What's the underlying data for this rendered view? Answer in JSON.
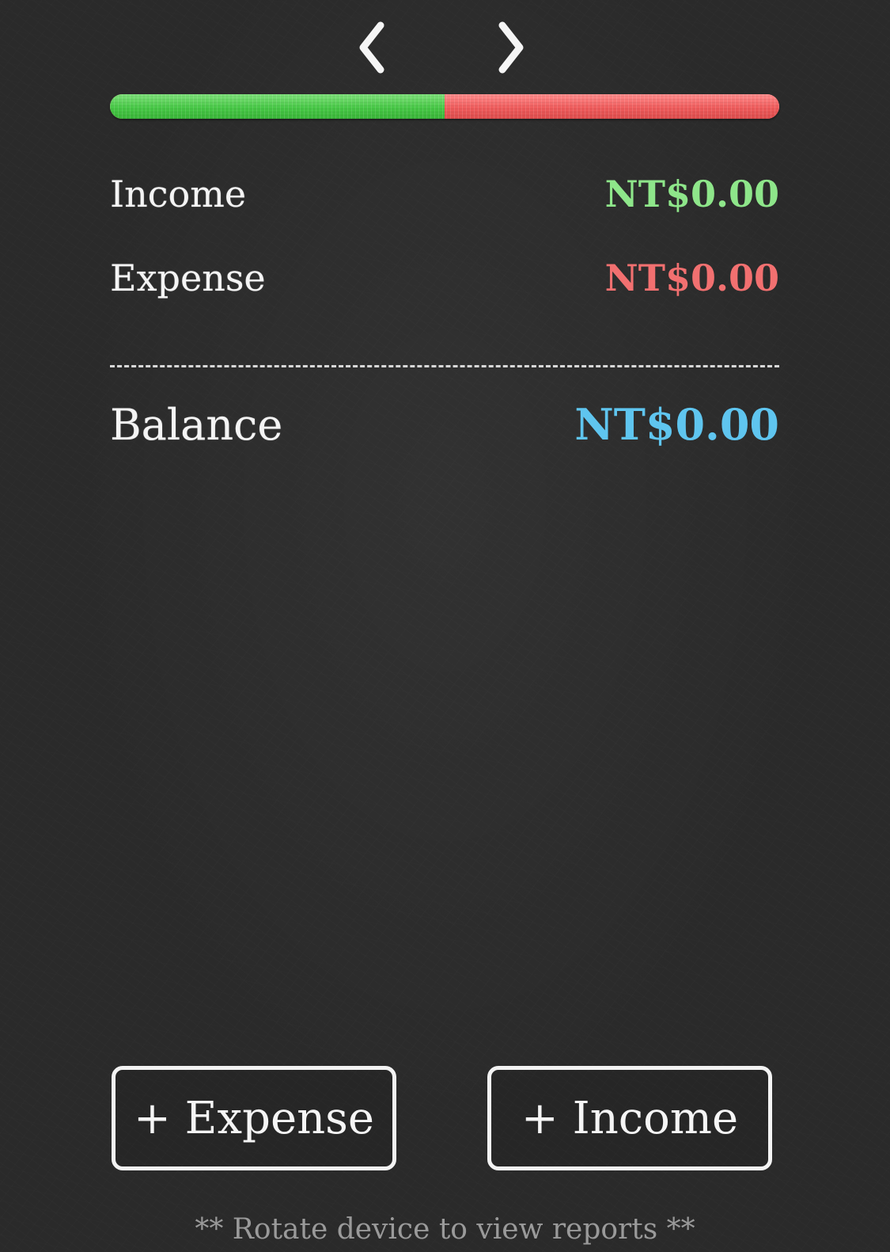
{
  "navigation": {
    "prev_icon": "chevron-left-icon",
    "next_icon": "chevron-right-icon"
  },
  "ratio_bar": {
    "income_fraction": 0.5,
    "expense_fraction": 0.5,
    "income_color": "#47c846",
    "expense_color": "#ef5c5c"
  },
  "summary": {
    "income_label": "Income",
    "income_value": "NT$0.00",
    "expense_label": "Expense",
    "expense_value": "NT$0.00",
    "balance_label": "Balance",
    "balance_value": "NT$0.00"
  },
  "colors": {
    "income": "#8ee68a",
    "expense": "#f27070",
    "balance": "#5fc5ef",
    "background": "#2a2a2a"
  },
  "actions": {
    "add_expense_label": "+ Expense",
    "add_income_label": "+ Income"
  },
  "footer": {
    "hint": "** Rotate device to view reports **"
  }
}
